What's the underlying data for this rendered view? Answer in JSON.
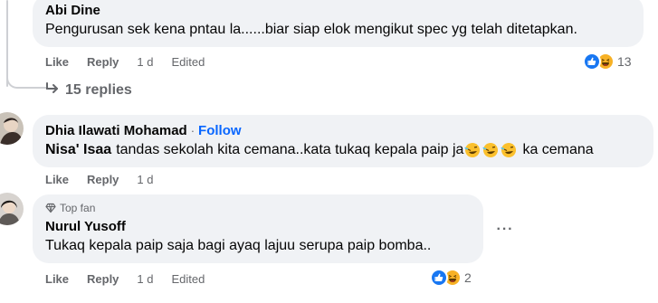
{
  "comments": [
    {
      "author": "Abi Dine",
      "text": "Pengurusan sek kena pntau la......biar siap elok mengikut spec yg telah ditetapkan.",
      "actions": {
        "like": "Like",
        "reply": "Reply",
        "time": "1 d",
        "edited": "Edited"
      },
      "reaction_count": "13"
    },
    {
      "author": "Dhia Ilawati Mohamad",
      "separator": "·",
      "follow": "Follow",
      "mention": "Nisa' Isaa",
      "text_part1": "tandas sekolah kita cemana..kata tukaq kepala paip ja",
      "text_part2": "ka cemana",
      "actions": {
        "like": "Like",
        "reply": "Reply",
        "time": "1 d"
      }
    },
    {
      "badge": "Top fan",
      "author": "Nurul Yusoff",
      "text": "Tukaq kepala paip saja bagi ayaq lajuu serupa paip bomba..",
      "actions": {
        "like": "Like",
        "reply": "Reply",
        "time": "1 d",
        "edited": "Edited"
      },
      "reaction_count": "2"
    }
  ],
  "replies_label": "15 replies",
  "more_label": "···",
  "icons": [
    "like-reaction-icon",
    "haha-reaction-icon",
    "rofl-emoji-icon",
    "reply-arrow-icon",
    "diamond-badge-icon",
    "more-options-icon"
  ]
}
